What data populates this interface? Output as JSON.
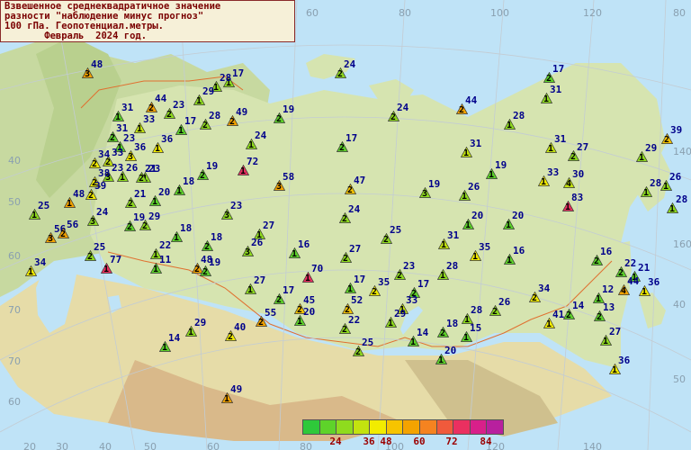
{
  "title": {
    "line1": "Взвешенное среднеквадратичное значение",
    "line2": "разности \"наблюдение минус прогноз\"",
    "line3": "100 гПа. Геопотенциал.метры.",
    "line4": "       Февраль  2024 год."
  },
  "legend": {
    "colors": [
      "#2ec93a",
      "#5ed32a",
      "#8fdb1e",
      "#c3e30f",
      "#f2ec00",
      "#f7c400",
      "#f4a300",
      "#f58320",
      "#f05a3c",
      "#ea3060",
      "#d8208a",
      "#b8209e"
    ],
    "labels": [
      "24",
      "36",
      "48",
      "60",
      "72",
      "84"
    ]
  },
  "grid_labels": [
    "60",
    "80",
    "100",
    "120",
    "140",
    "160",
    "40",
    "50",
    "60",
    "70",
    "80",
    "20",
    "30",
    "40",
    "50",
    "60",
    "80",
    "100",
    "120",
    "140",
    "40",
    "50",
    "60",
    "70"
  ],
  "stations": [
    {
      "value": "48",
      "count": "3",
      "color": "#f4a300"
    },
    {
      "value": "17",
      "count": "1",
      "color": "#8fdb1e"
    },
    {
      "value": "28",
      "count": "1",
      "color": "#8fdb1e"
    },
    {
      "value": "29",
      "count": "1",
      "color": "#8fdb1e"
    },
    {
      "value": "24",
      "count": "2",
      "color": "#8fdb1e"
    },
    {
      "value": "44",
      "count": "2",
      "color": "#f4a300"
    },
    {
      "value": "31",
      "count": "1",
      "color": "#5ed32a"
    },
    {
      "value": "23",
      "count": "2",
      "color": "#8fdb1e"
    },
    {
      "value": "49",
      "count": "2",
      "color": "#f4a300"
    },
    {
      "value": "28",
      "count": "2",
      "color": "#8fdb1e"
    },
    {
      "value": "19",
      "count": "2",
      "color": "#5ed32a"
    },
    {
      "value": "24",
      "count": "2",
      "color": "#8fdb1e"
    },
    {
      "value": "17",
      "count": "2",
      "color": "#5ed32a"
    },
    {
      "value": "44",
      "count": "2",
      "color": "#f4a300"
    },
    {
      "value": "28",
      "count": "1",
      "color": "#8fdb1e"
    },
    {
      "value": "17",
      "count": "1",
      "color": "#5ed32a"
    },
    {
      "value": "31",
      "count": "1",
      "color": "#8fdb1e"
    },
    {
      "value": "39",
      "count": "2",
      "color": "#f7c400"
    },
    {
      "value": "31",
      "count": "2",
      "color": "#5ed32a"
    },
    {
      "value": "24",
      "count": "1",
      "color": "#8fdb1e"
    },
    {
      "value": "33",
      "count": "1",
      "color": "#c3e30f"
    },
    {
      "value": "23",
      "count": "1",
      "color": "#5ed32a"
    },
    {
      "value": "31",
      "count": "1",
      "color": "#c3e30f"
    },
    {
      "value": "36",
      "count": "1",
      "color": "#f2ec00"
    },
    {
      "value": "33",
      "count": "2",
      "color": "#c3e30f"
    },
    {
      "value": "27",
      "count": "2",
      "color": "#8fdb1e"
    },
    {
      "value": "29",
      "count": "1",
      "color": "#8fdb1e"
    },
    {
      "value": "26",
      "count": "1",
      "color": "#8fdb1e"
    },
    {
      "value": "34",
      "count": "2",
      "color": "#f2ec00"
    },
    {
      "value": "36",
      "count": "3",
      "color": "#f2ec00"
    },
    {
      "value": "23",
      "count": "3",
      "color": "#8fdb1e"
    },
    {
      "value": "17",
      "count": "2",
      "color": "#5ed32a"
    },
    {
      "value": "72",
      "count": "1",
      "color": "#ea3060"
    },
    {
      "value": "19",
      "count": "2",
      "color": "#5ed32a"
    },
    {
      "value": "31",
      "count": "1",
      "color": "#c3e30f"
    },
    {
      "value": "23",
      "count": "1",
      "color": "#8fdb1e"
    },
    {
      "value": "19",
      "count": "1",
      "color": "#5ed32a"
    },
    {
      "value": "33",
      "count": "1",
      "color": "#f2ec00"
    },
    {
      "value": "30",
      "count": "4",
      "color": "#c3e30f"
    },
    {
      "value": "38",
      "count": "2",
      "color": "#f2ec00"
    },
    {
      "value": "21",
      "count": "2",
      "color": "#8fdb1e"
    },
    {
      "value": "58",
      "count": "3",
      "color": "#f4a300"
    },
    {
      "value": "47",
      "count": "2",
      "color": "#f7c400"
    },
    {
      "value": "19",
      "count": "3",
      "color": "#8fdb1e"
    },
    {
      "value": "26",
      "count": "1",
      "color": "#8fdb1e"
    },
    {
      "value": "28",
      "count": "1",
      "color": "#8fdb1e"
    },
    {
      "value": "26",
      "count": "1",
      "color": "#8fdb1e"
    },
    {
      "value": "28",
      "count": "1",
      "color": "#8fdb1e"
    },
    {
      "value": "39",
      "count": "2",
      "color": "#f2ec00"
    },
    {
      "value": "18",
      "count": "1",
      "color": "#5ed32a"
    },
    {
      "value": "48",
      "count": "1",
      "color": "#f4a300"
    },
    {
      "value": "21",
      "count": "2",
      "color": "#8fdb1e"
    },
    {
      "value": "20",
      "count": "1",
      "color": "#5ed32a"
    },
    {
      "value": "83",
      "count": "1",
      "color": "#ea3060"
    },
    {
      "value": "25",
      "count": "1",
      "color": "#8fdb1e"
    },
    {
      "value": "23",
      "count": "3",
      "color": "#8fdb1e"
    },
    {
      "value": "20",
      "count": "1",
      "color": "#5ed32a"
    },
    {
      "value": "24",
      "count": "2",
      "color": "#8fdb1e"
    },
    {
      "value": "20",
      "count": "1",
      "color": "#5ed32a"
    },
    {
      "value": "19",
      "count": "2",
      "color": "#5ed32a"
    },
    {
      "value": "24",
      "count": "3",
      "color": "#8fdb1e"
    },
    {
      "value": "29",
      "count": "2",
      "color": "#8fdb1e"
    },
    {
      "value": "56",
      "count": "3",
      "color": "#f4a300"
    },
    {
      "value": "56",
      "count": "2",
      "color": "#f4a300"
    },
    {
      "value": "18",
      "count": "1",
      "color": "#5ed32a"
    },
    {
      "value": "27",
      "count": "1",
      "color": "#8fdb1e"
    },
    {
      "value": "25",
      "count": "2",
      "color": "#8fdb1e"
    },
    {
      "value": "31",
      "count": "1",
      "color": "#c3e30f"
    },
    {
      "value": "35",
      "count": "1",
      "color": "#f2ec00"
    },
    {
      "value": "16",
      "count": "1",
      "color": "#5ed32a"
    },
    {
      "value": "16",
      "count": "2",
      "color": "#5ed32a"
    },
    {
      "value": "22",
      "count": "2",
      "color": "#5ed32a"
    },
    {
      "value": "21",
      "count": "1",
      "color": "#5ed32a"
    },
    {
      "value": "22",
      "count": "1",
      "color": "#8fdb1e"
    },
    {
      "value": "18",
      "count": "2",
      "color": "#5ed32a"
    },
    {
      "value": "26",
      "count": "3",
      "color": "#8fdb1e"
    },
    {
      "value": "16",
      "count": "1",
      "color": "#5ed32a"
    },
    {
      "value": "27",
      "count": "2",
      "color": "#8fdb1e"
    },
    {
      "value": "25",
      "count": "2",
      "color": "#8fdb1e"
    },
    {
      "value": "77",
      "count": "1",
      "color": "#ea3060"
    },
    {
      "value": "34",
      "count": "1",
      "color": "#f2ec00"
    },
    {
      "value": "11",
      "count": "1",
      "color": "#5ed32a"
    },
    {
      "value": "48",
      "count": "2",
      "color": "#f4a300"
    },
    {
      "value": "19",
      "count": "2",
      "color": "#5ed32a"
    },
    {
      "value": "70",
      "count": "1",
      "color": "#ea3060"
    },
    {
      "value": "23",
      "count": "2",
      "color": "#8fdb1e"
    },
    {
      "value": "28",
      "count": "1",
      "color": "#8fdb1e"
    },
    {
      "value": "17",
      "count": "1",
      "color": "#5ed32a"
    },
    {
      "value": "34",
      "count": "2",
      "color": "#f2ec00"
    },
    {
      "value": "12",
      "count": "1",
      "color": "#5ed32a"
    },
    {
      "value": "44",
      "count": "4",
      "color": "#f4a300"
    },
    {
      "value": "36",
      "count": "1",
      "color": "#f2ec00"
    },
    {
      "value": "27",
      "count": "1",
      "color": "#8fdb1e"
    },
    {
      "value": "17",
      "count": "2",
      "color": "#5ed32a"
    },
    {
      "value": "17",
      "count": "2",
      "color": "#5ed32a"
    },
    {
      "value": "35",
      "count": "2",
      "color": "#f2ec00"
    },
    {
      "value": "52",
      "count": "2",
      "color": "#f7c400"
    },
    {
      "value": "45",
      "count": "2",
      "color": "#f7c400"
    },
    {
      "value": "33",
      "count": "1",
      "color": "#c3e30f"
    },
    {
      "value": "28",
      "count": "1",
      "color": "#8fdb1e"
    },
    {
      "value": "26",
      "count": "2",
      "color": "#8fdb1e"
    },
    {
      "value": "14",
      "count": "2",
      "color": "#5ed32a"
    },
    {
      "value": "13",
      "count": "2",
      "color": "#5ed32a"
    },
    {
      "value": "29",
      "count": "1",
      "color": "#8fdb1e"
    },
    {
      "value": "40",
      "count": "2",
      "color": "#f2ec00"
    },
    {
      "value": "55",
      "count": "2",
      "color": "#f4a300"
    },
    {
      "value": "20",
      "count": "1",
      "color": "#5ed32a"
    },
    {
      "value": "22",
      "count": "2",
      "color": "#8fdb1e"
    },
    {
      "value": "29",
      "count": "1",
      "color": "#8fdb1e"
    },
    {
      "value": "18",
      "count": "2",
      "color": "#5ed32a"
    },
    {
      "value": "15",
      "count": "1",
      "color": "#5ed32a"
    },
    {
      "value": "41",
      "count": "1",
      "color": "#f2ec00"
    },
    {
      "value": "27",
      "count": "1",
      "color": "#8fdb1e"
    },
    {
      "value": "14",
      "count": "1",
      "color": "#5ed32a"
    },
    {
      "value": "25",
      "count": "2",
      "color": "#8fdb1e"
    },
    {
      "value": "14",
      "count": "1",
      "color": "#5ed32a"
    },
    {
      "value": "20",
      "count": "1",
      "color": "#5ed32a"
    },
    {
      "value": "36",
      "count": "1",
      "color": "#f2ec00"
    },
    {
      "value": "49",
      "count": "1",
      "color": "#f4a300"
    }
  ]
}
